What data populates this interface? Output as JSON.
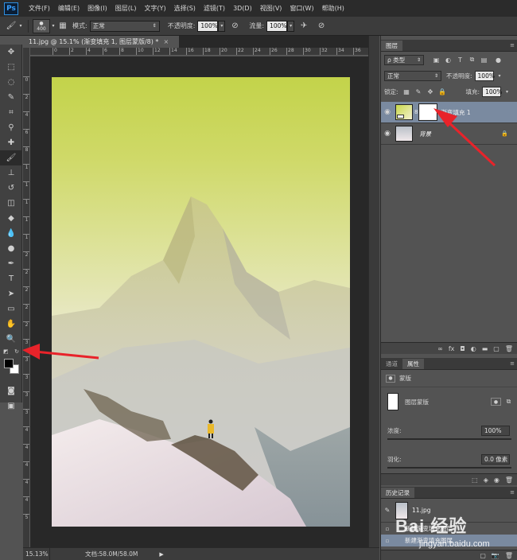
{
  "app": {
    "logo": "Ps"
  },
  "menu": [
    "文件(F)",
    "编辑(E)",
    "图像(I)",
    "图层(L)",
    "文字(Y)",
    "选择(S)",
    "滤镜(T)",
    "3D(D)",
    "视图(V)",
    "窗口(W)",
    "帮助(H)"
  ],
  "options": {
    "brush_size": "400",
    "mode_label": "模式:",
    "mode_value": "正常",
    "opacity_label": "不透明度:",
    "opacity_value": "100%",
    "flow_label": "流量:",
    "flow_value": "100%"
  },
  "document": {
    "tab_title": "11.jpg @ 15.1% (渐变填充 1, 图层蒙版/8) *",
    "close": "×",
    "zoom": "15.13%",
    "doc_size": "文档:58.0M/58.0M"
  },
  "rulers": {
    "h": [
      "0",
      "2",
      "4",
      "6",
      "8",
      "10",
      "12",
      "14",
      "16",
      "18",
      "20",
      "22",
      "24",
      "26",
      "28",
      "30",
      "32",
      "34",
      "36"
    ],
    "v": [
      "0",
      "2",
      "4",
      "6",
      "8",
      "1",
      "1",
      "1",
      "1",
      "1",
      "2",
      "2",
      "2",
      "2",
      "2",
      "3",
      "3",
      "3",
      "3",
      "3",
      "4",
      "4",
      "4",
      "4",
      "4",
      "5"
    ]
  },
  "layers_panel": {
    "tab": "图层",
    "filter_label": "ρ 类型",
    "blend_mode": "正常",
    "opacity_label": "不透明度:",
    "opacity_value": "100%",
    "lock_label": "锁定:",
    "fill_label": "填充:",
    "fill_value": "100%",
    "layers": [
      {
        "name": "渐变填充 1",
        "visible": true,
        "selected": true
      },
      {
        "name": "背景",
        "visible": true,
        "selected": false,
        "locked": true
      }
    ]
  },
  "properties_panel": {
    "tabs": [
      "通道",
      "属性"
    ],
    "header": "蒙版",
    "mask_type": "图层蒙版",
    "density_label": "浓度:",
    "density_value": "100%",
    "feather_label": "羽化:",
    "feather_value": "0.0 像素"
  },
  "history_panel": {
    "tab": "历史记录",
    "items": [
      "11.jpg",
      "新建渐变填充图层"
    ]
  },
  "watermark": {
    "brand": "Bai 经验",
    "url": "jingyan.baidu.com"
  },
  "colors": {
    "accent_arrow": "#e8232a",
    "foreground": "#000000",
    "background": "#ffffff",
    "selection": "#7a8aa0"
  }
}
